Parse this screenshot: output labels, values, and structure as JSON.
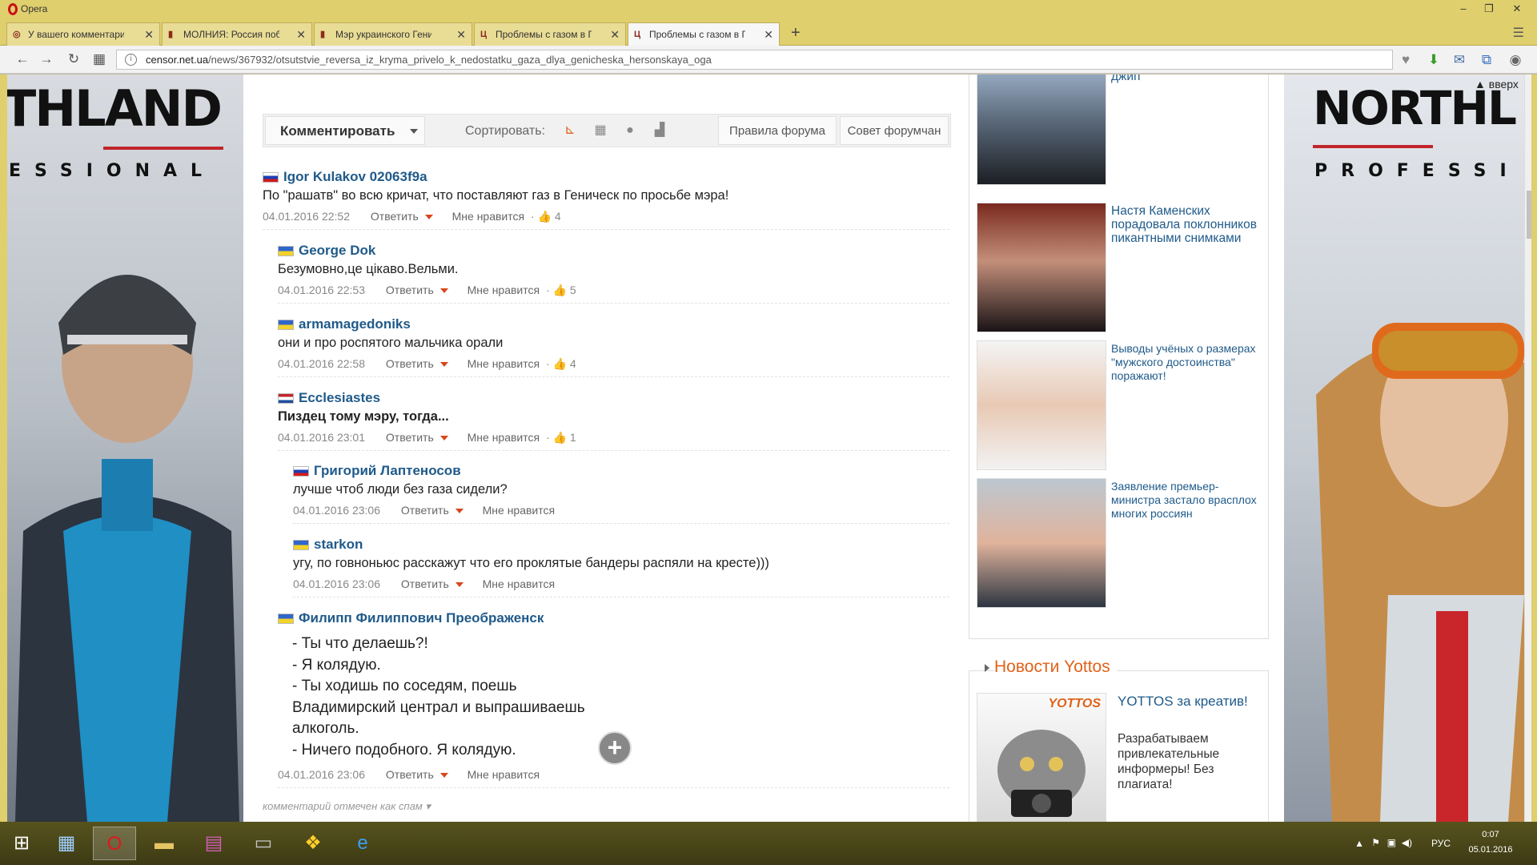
{
  "window": {
    "title": "Opera"
  },
  "tabs": [
    {
      "label": "У вашего комментария п",
      "icon": "censor-favicon"
    },
    {
      "label": "МОЛНИЯ: Россия побед",
      "icon": "censor-favicon"
    },
    {
      "label": "Мэр украинского Генич",
      "icon": "censor-favicon"
    },
    {
      "label": "Проблемы с газом в Ген",
      "icon": "censor-favicon"
    },
    {
      "label": "Проблемы с газом в Ген",
      "icon": "censor-favicon",
      "active": true
    }
  ],
  "address": {
    "domain": "censor.net.ua",
    "path": "/news/367932/otsutstvie_reversa_iz_kryma_privelo_k_nedostatku_gaza_dlya_genicheska_hersonskaya_oga"
  },
  "ads": {
    "left_brand": "THLAND",
    "left_sub": "ESSIONAL",
    "right_brand": "NORTHL",
    "right_sub": "PROFESSI"
  },
  "toolbar": {
    "comment_button": "Комментировать",
    "sort_label": "Сортировать:",
    "rules_button": "Правила форума",
    "advice_button": "Совет форумчан"
  },
  "comments": [
    {
      "author": "Igor Kulakov 02063f9a",
      "flag": "ru",
      "text": "По \"рашатв\" во всю кричат, что поставляют газ в Геническ по просьбе мэра!",
      "date": "04.01.2016 22:52",
      "reply": "Ответить",
      "like": "Мне нравится",
      "likes": "4"
    },
    {
      "author": "George Dok",
      "flag": "ua",
      "text": "Безумовно,це цікаво.Вельми.",
      "date": "04.01.2016 22:53",
      "reply": "Ответить",
      "like": "Мне нравится",
      "likes": "5"
    },
    {
      "author": "armamagedoniks",
      "flag": "ua",
      "text": "они и про роспятого мальчика орали",
      "date": "04.01.2016 22:58",
      "reply": "Ответить",
      "like": "Мне нравится",
      "likes": "4"
    },
    {
      "author": "Ecclesiastes",
      "flag": "nl",
      "text": "Пиздец тому мэру, тогда...",
      "date": "04.01.2016 23:01",
      "reply": "Ответить",
      "like": "Мне нравится",
      "likes": "1"
    },
    {
      "author": "Григорий Лаптеносов",
      "flag": "ru",
      "text": "лучше чтоб люди без газа сидели?",
      "date": "04.01.2016 23:06",
      "reply": "Ответить",
      "like": "Мне нравится",
      "likes": ""
    },
    {
      "author": "starkon",
      "flag": "ua",
      "text": "угу, по говноньюс расскажут что его проклятые бандеры распяли на кресте)))",
      "date": "04.01.2016 23:06",
      "reply": "Ответить",
      "like": "Мне нравится",
      "likes": ""
    },
    {
      "author": "Филипп Филиппович Преображенск",
      "flag": "ua",
      "text": "- Ты что делаешь?!\n- Я колядую.\n- Ты ходишь по соседям, поешь\nВладимирский централ и выпрашиваешь\nалкоголь.\n- Ничего подобного. Я колядую.",
      "date": "04.01.2016 23:06",
      "reply": "Ответить",
      "like": "Мне нравится",
      "likes": ""
    }
  ],
  "spam_note": "комментарий отмечен как спам",
  "sidebar": {
    "up_link": "вверх",
    "promos": [
      {
        "text": "джип"
      },
      {
        "text": "Настя Каменских порадовала поклонников пикантными снимками"
      },
      {
        "text": "Выводы учёных о размерах \"мужского достоинства\" поражают!"
      },
      {
        "text": "Заявление премьер-министра застало врасплох многих россиян"
      }
    ],
    "yottos": {
      "heading": "Новости Yottos",
      "logo": "YOTTOS",
      "title": "YOTTOS за креатив!",
      "desc": "Разрабатываем привлекательные информеры! Без плагиата!"
    }
  },
  "taskbar": {
    "lang": "РУС",
    "time": "0:07",
    "date": "05.01.2016"
  },
  "colors": {
    "link": "#1f5a8a",
    "accent": "#e0621a",
    "opera_chrome": "#dfcf6d",
    "taskbar": "#4a4618"
  }
}
